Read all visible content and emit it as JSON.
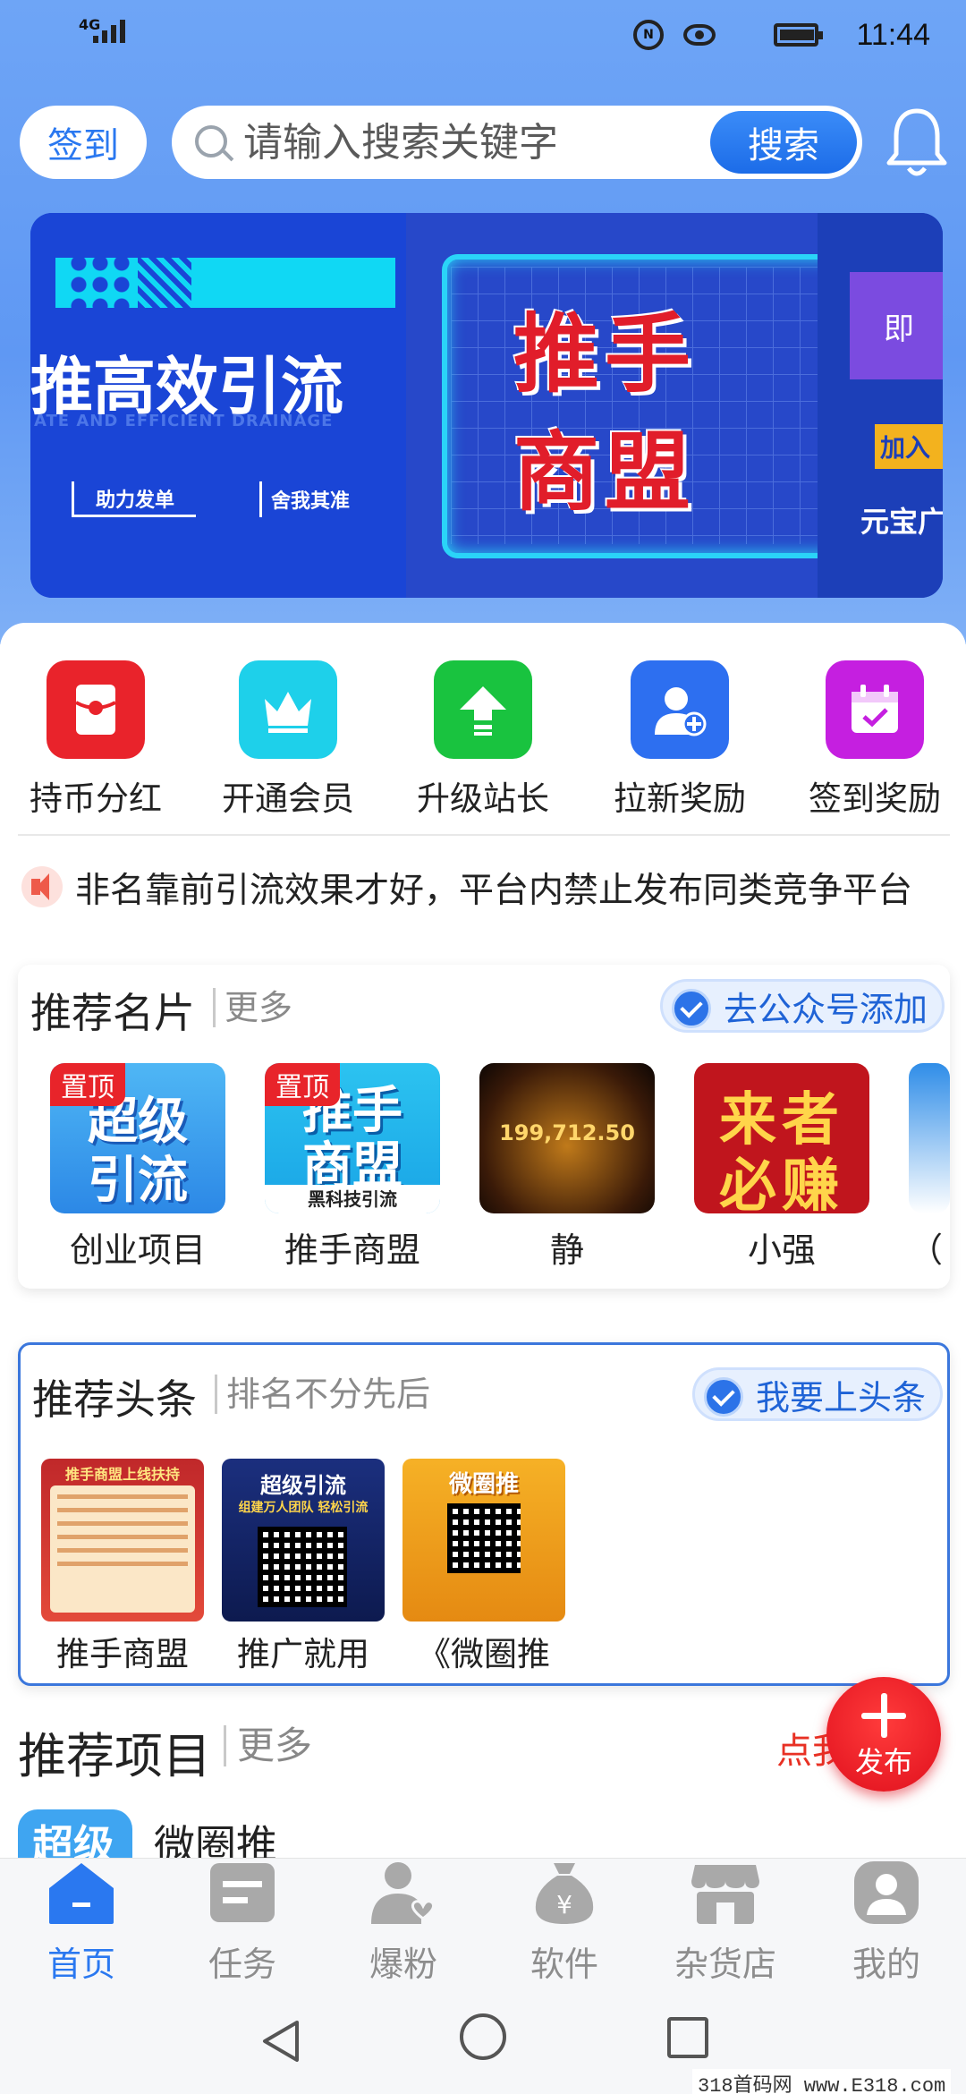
{
  "status_bar": {
    "network": "4G",
    "time": "11:44",
    "nfc_label": "N"
  },
  "header": {
    "signin_label": "签到",
    "search_placeholder": "请输入搜索关键字",
    "search_button": "搜索"
  },
  "banner": {
    "left_title": "推高效引流",
    "left_sub": "ATE AND EFFICIENT DRAINAGE",
    "left_tag1": "助力发单",
    "left_tag2": "舍我其准",
    "center_line1": "推手",
    "center_line2": "商盟",
    "right_box": "即",
    "right_join": "加入",
    "right_brand": "元宝广"
  },
  "features": [
    {
      "label": "持币分红",
      "color": "#e9232b",
      "icon": "red-envelope-icon"
    },
    {
      "label": "开通会员",
      "color": "#1ed0ea",
      "icon": "crown-icon"
    },
    {
      "label": "升级站长",
      "color": "#19c33f",
      "icon": "upgrade-arrow-icon"
    },
    {
      "label": "拉新奖励",
      "color": "#2d6ff0",
      "icon": "add-user-icon"
    },
    {
      "label": "签到奖励",
      "color": "#c51fe0",
      "icon": "calendar-check-icon"
    }
  ],
  "notice": {
    "text": "非名靠前引流效果才好，平台内禁止发布同类竞争平台"
  },
  "recommended_cards": {
    "title": "推荐名片",
    "more": "更多",
    "action": "去公众号添加",
    "pin_label": "置顶",
    "items": [
      {
        "name": "创业项目",
        "pinned": true,
        "art_line1": "超级",
        "art_line2": "引流"
      },
      {
        "name": "推手商盟",
        "pinned": true,
        "art_line1": "推手",
        "art_line2": "商盟",
        "art_line3": "黑科技引流"
      },
      {
        "name": "静",
        "pinned": false,
        "art_line1": "199,712.50"
      },
      {
        "name": "小强",
        "pinned": false,
        "art_line1": "来者",
        "art_line2": "必赚"
      },
      {
        "name": "（",
        "pinned": false
      }
    ]
  },
  "headlines": {
    "title": "推荐头条",
    "more": "排名不分先后",
    "action": "我要上头条",
    "items": [
      {
        "name": "推手商盟",
        "art_line1": "推手商盟上线扶持"
      },
      {
        "name": "推广就用",
        "art_line1": "超级引流",
        "art_line2": "组建万人团队 轻松引流"
      },
      {
        "name": "《微圈推",
        "art_line1": "微圈推"
      }
    ]
  },
  "projects": {
    "title": "推荐项目",
    "more": "更多",
    "cta": "点我",
    "first_item": {
      "name": "微圈推",
      "thumb_text": "超级"
    }
  },
  "fab": {
    "label": "发布"
  },
  "tabs": [
    {
      "label": "首页",
      "icon": "home-icon",
      "active": true
    },
    {
      "label": "任务",
      "icon": "task-icon",
      "active": false
    },
    {
      "label": "爆粉",
      "icon": "fans-icon",
      "active": false
    },
    {
      "label": "软件",
      "icon": "money-bag-icon",
      "active": false
    },
    {
      "label": "杂货店",
      "icon": "store-icon",
      "active": false
    },
    {
      "label": "我的",
      "icon": "profile-icon",
      "active": false
    }
  ],
  "watermark": "318首码网 www.E318.com"
}
